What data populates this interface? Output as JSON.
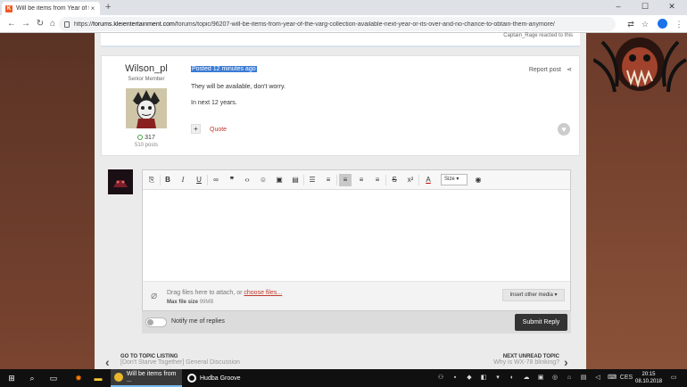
{
  "browser": {
    "tab_title": "Will be items from Year of the V...",
    "url_prefix": "https://",
    "url_host": "forums.kleientertainment.com",
    "url_path": "/forums/topic/96207-will-be-items-from-year-of-the-varg-collection-available-next-year-or-its-over-and-no-chance-to-obtain-them-anymore/"
  },
  "prev_post": {
    "reacted_text": "Captain_Rage reacted to this"
  },
  "post": {
    "author_name": "Wilson_pl",
    "author_title": "Senior Member",
    "reputation": "317",
    "post_count": "510 posts",
    "posted": "Posted 12 minutes ago",
    "report": "Report post",
    "lines": [
      "They will be available, don't worry.",
      "In next 12 years."
    ],
    "plus": "+",
    "quote": "Quote"
  },
  "editor": {
    "size_label": "Size",
    "drag_text": "Drag files here to attach, or ",
    "choose_files": "choose files...",
    "max_label": "Max file size",
    "max_value": "99MB",
    "insert_media": "Insert other media",
    "notify": "Notify me of replies",
    "submit": "Submit Reply"
  },
  "topic_nav": {
    "prev_label": "GO TO TOPIC LISTING",
    "prev_sub": "[Don't Starve Together] General Discussion",
    "next_label": "NEXT UNREAD TOPIC",
    "next_sub": "Why is WX-78 blinking?"
  },
  "taskbar": {
    "chrome_label": "Will be items from ...",
    "groove_label": "Hudba Groove",
    "lang": "CES",
    "time": "20:15",
    "date": "08.10.2018"
  },
  "colors": {
    "highlight": "#3a7bd5",
    "link": "#c0392b",
    "accent": "#4aa04a"
  }
}
